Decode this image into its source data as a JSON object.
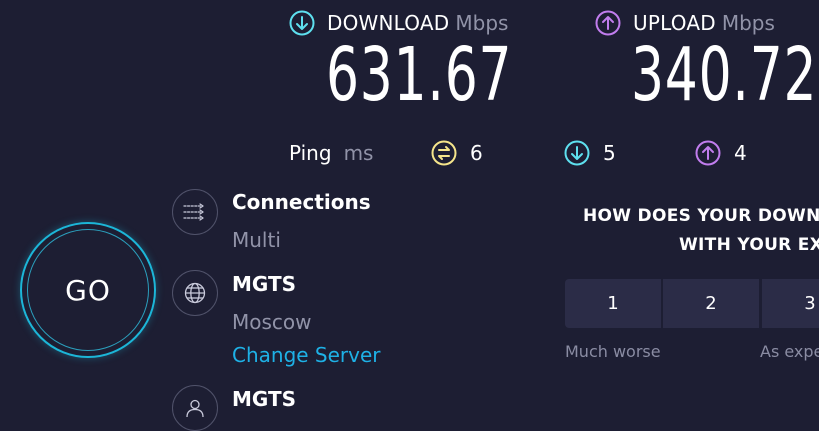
{
  "download": {
    "title": "DOWNLOAD",
    "unit": "Mbps",
    "value": "631.67",
    "icon": "arrow-down-circle-icon",
    "color": "#5ee0ef"
  },
  "upload": {
    "title": "UPLOAD",
    "unit": "Mbps",
    "value": "340.72",
    "icon": "arrow-up-circle-icon",
    "color": "#c17dee"
  },
  "ping": {
    "label": "Ping",
    "unit": "ms",
    "idle": {
      "value": "6",
      "icon": "idle-ping-icon",
      "color": "#f5e58b"
    },
    "download": {
      "value": "5",
      "icon": "arrow-down-circle-icon",
      "color": "#5ee0ef"
    },
    "upload": {
      "value": "4",
      "icon": "arrow-up-circle-icon",
      "color": "#c17dee"
    }
  },
  "go_button": {
    "label": "GO",
    "color": "#1cb6d8"
  },
  "connections": {
    "title": "Connections",
    "value": "Multi",
    "icon": "connections-icon"
  },
  "server": {
    "title": "MGTS",
    "location": "Moscow",
    "change_link": "Change Server",
    "icon": "globe-icon"
  },
  "provider": {
    "title": "MGTS",
    "icon": "user-icon"
  },
  "survey": {
    "question_line1": "HOW DOES YOUR DOWN",
    "question_line2": "WITH YOUR EX",
    "options": [
      "1",
      "2",
      "3"
    ],
    "label_low": "Much worse",
    "label_mid": "As expe"
  }
}
